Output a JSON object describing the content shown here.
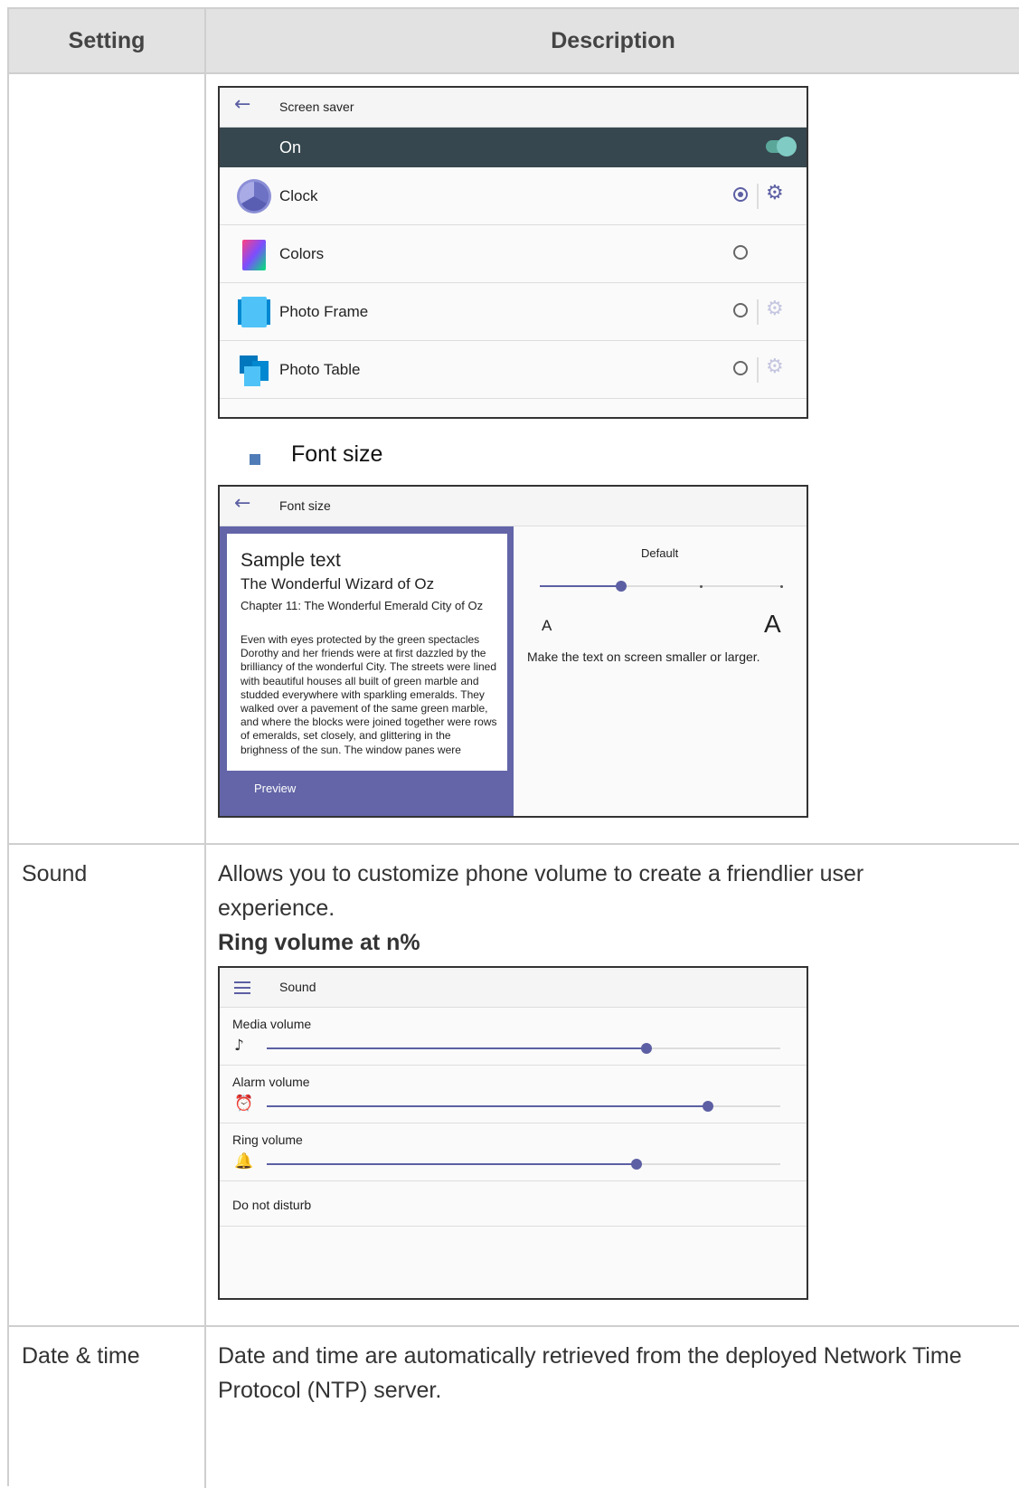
{
  "table": {
    "header": {
      "setting": "Setting",
      "description": "Description"
    },
    "rows": [
      {
        "setting": "",
        "bullet": "Font size"
      },
      {
        "setting": "Sound",
        "description": "Allows you to customize phone volume to create a friendlier user experience.",
        "subheading": "Ring volume at n%"
      },
      {
        "setting": "Date & time",
        "description": "Date and time are automatically retrieved from the deployed Network Time Protocol (NTP) server."
      }
    ]
  },
  "screen_saver": {
    "title": "Screen saver",
    "back_icon": "arrow-left-icon",
    "on_label": "On",
    "toggle_on": true,
    "options": [
      {
        "label": "Clock",
        "selected": true,
        "has_settings": true,
        "settings_enabled": true,
        "icon": "clock-app-icon"
      },
      {
        "label": "Colors",
        "selected": false,
        "has_settings": false,
        "icon": "colors-app-icon"
      },
      {
        "label": "Photo Frame",
        "selected": false,
        "has_settings": true,
        "settings_enabled": false,
        "icon": "photo-frame-app-icon"
      },
      {
        "label": "Photo Table",
        "selected": false,
        "has_settings": true,
        "settings_enabled": false,
        "icon": "photo-table-app-icon"
      }
    ]
  },
  "font_size": {
    "title": "Font size",
    "preview": {
      "heading": "Sample text",
      "book_title": "The Wonderful Wizard of Oz",
      "chapter": "Chapter 11: The Wonderful Emerald City of Oz",
      "body": "Even with eyes protected by the green spectacles Dorothy and her friends were at first dazzled by the brilliancy of the wonderful City. The streets were lined with beautiful houses all built of green marble and studded everywhere with sparkling emeralds. They walked over a pavement of the same green marble, and where the blocks were joined together were rows of emeralds, set closely, and glittering in the brighness of the sun. The window panes were",
      "label": "Preview"
    },
    "current_label": "Default",
    "level_index": 1,
    "level_count": 4,
    "small_a": "A",
    "large_a": "A",
    "hint": "Make the text on screen smaller or larger."
  },
  "sound": {
    "title": "Sound",
    "menu_icon": "hamburger-menu-icon",
    "sliders": [
      {
        "label": "Media volume",
        "icon": "music-note-icon",
        "glyph": "♪",
        "level": 0.74
      },
      {
        "label": "Alarm volume",
        "icon": "alarm-clock-icon",
        "glyph": "⏰",
        "level": 0.86
      },
      {
        "label": "Ring volume",
        "icon": "bell-icon",
        "glyph": "🔔",
        "level": 0.72
      }
    ],
    "dnd_label": "Do not disturb"
  },
  "colors": {
    "accent": "#5c5fa3",
    "on_bar": "#37474f",
    "toggle": "#80cbc4",
    "bullet": "#4f7cb7"
  }
}
